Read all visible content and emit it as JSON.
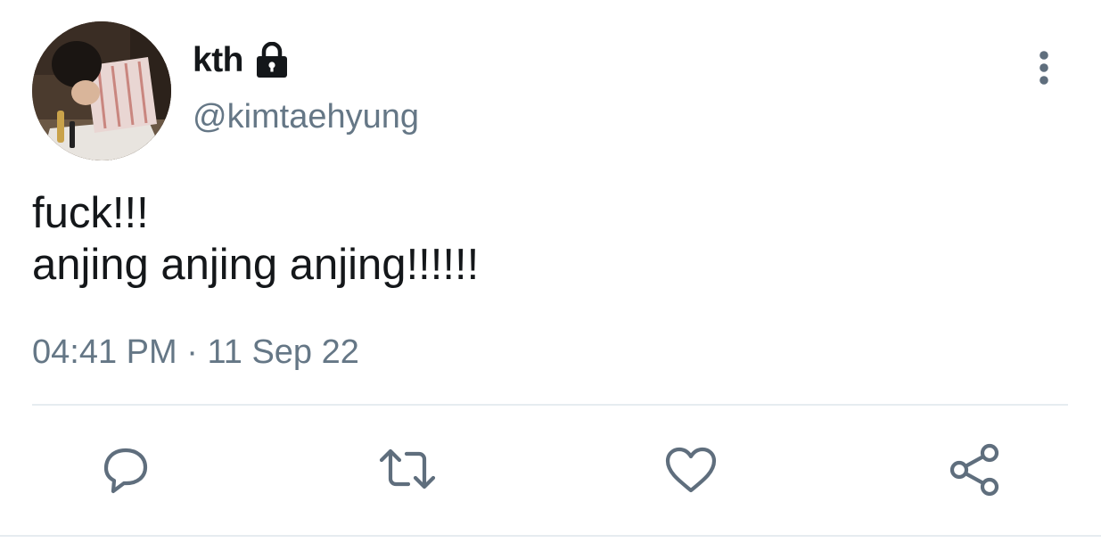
{
  "author": {
    "display_name": "kth",
    "handle": "@kimtaehyung",
    "protected_icon": "lock-icon",
    "avatar": "profile-photo"
  },
  "tweet": {
    "lines": [
      "fuck!!!",
      "anjing anjing anjing!!!!!!"
    ],
    "time": "04:41 PM",
    "separator": "·",
    "date": "11 Sep 22"
  },
  "actions": {
    "reply_icon": "reply-icon",
    "retweet_icon": "retweet-icon",
    "like_icon": "heart-icon",
    "share_icon": "share-icon",
    "more_icon": "more-vertical-icon"
  },
  "colors": {
    "text": "#14171a",
    "secondary": "#657786",
    "divider": "#e6ecf0",
    "icon": "#5f6e7d"
  }
}
